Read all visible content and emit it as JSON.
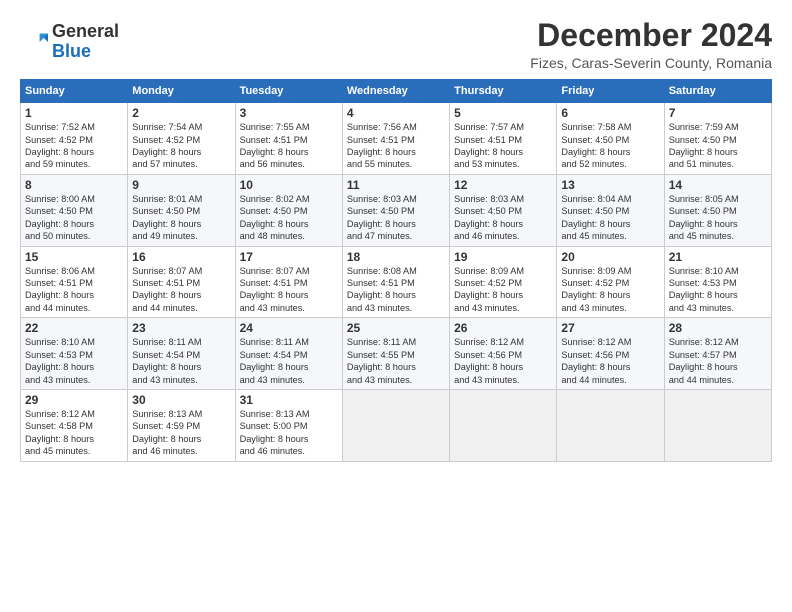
{
  "header": {
    "logo": {
      "general": "General",
      "blue": "Blue"
    },
    "title": "December 2024",
    "subtitle": "Fizes, Caras-Severin County, Romania"
  },
  "calendar": {
    "headers": [
      "Sunday",
      "Monday",
      "Tuesday",
      "Wednesday",
      "Thursday",
      "Friday",
      "Saturday"
    ],
    "rows": [
      [
        {
          "day": "1",
          "info": "Sunrise: 7:52 AM\nSunset: 4:52 PM\nDaylight: 8 hours\nand 59 minutes."
        },
        {
          "day": "2",
          "info": "Sunrise: 7:54 AM\nSunset: 4:52 PM\nDaylight: 8 hours\nand 57 minutes."
        },
        {
          "day": "3",
          "info": "Sunrise: 7:55 AM\nSunset: 4:51 PM\nDaylight: 8 hours\nand 56 minutes."
        },
        {
          "day": "4",
          "info": "Sunrise: 7:56 AM\nSunset: 4:51 PM\nDaylight: 8 hours\nand 55 minutes."
        },
        {
          "day": "5",
          "info": "Sunrise: 7:57 AM\nSunset: 4:51 PM\nDaylight: 8 hours\nand 53 minutes."
        },
        {
          "day": "6",
          "info": "Sunrise: 7:58 AM\nSunset: 4:50 PM\nDaylight: 8 hours\nand 52 minutes."
        },
        {
          "day": "7",
          "info": "Sunrise: 7:59 AM\nSunset: 4:50 PM\nDaylight: 8 hours\nand 51 minutes."
        }
      ],
      [
        {
          "day": "8",
          "info": "Sunrise: 8:00 AM\nSunset: 4:50 PM\nDaylight: 8 hours\nand 50 minutes."
        },
        {
          "day": "9",
          "info": "Sunrise: 8:01 AM\nSunset: 4:50 PM\nDaylight: 8 hours\nand 49 minutes."
        },
        {
          "day": "10",
          "info": "Sunrise: 8:02 AM\nSunset: 4:50 PM\nDaylight: 8 hours\nand 48 minutes."
        },
        {
          "day": "11",
          "info": "Sunrise: 8:03 AM\nSunset: 4:50 PM\nDaylight: 8 hours\nand 47 minutes."
        },
        {
          "day": "12",
          "info": "Sunrise: 8:03 AM\nSunset: 4:50 PM\nDaylight: 8 hours\nand 46 minutes."
        },
        {
          "day": "13",
          "info": "Sunrise: 8:04 AM\nSunset: 4:50 PM\nDaylight: 8 hours\nand 45 minutes."
        },
        {
          "day": "14",
          "info": "Sunrise: 8:05 AM\nSunset: 4:50 PM\nDaylight: 8 hours\nand 45 minutes."
        }
      ],
      [
        {
          "day": "15",
          "info": "Sunrise: 8:06 AM\nSunset: 4:51 PM\nDaylight: 8 hours\nand 44 minutes."
        },
        {
          "day": "16",
          "info": "Sunrise: 8:07 AM\nSunset: 4:51 PM\nDaylight: 8 hours\nand 44 minutes."
        },
        {
          "day": "17",
          "info": "Sunrise: 8:07 AM\nSunset: 4:51 PM\nDaylight: 8 hours\nand 43 minutes."
        },
        {
          "day": "18",
          "info": "Sunrise: 8:08 AM\nSunset: 4:51 PM\nDaylight: 8 hours\nand 43 minutes."
        },
        {
          "day": "19",
          "info": "Sunrise: 8:09 AM\nSunset: 4:52 PM\nDaylight: 8 hours\nand 43 minutes."
        },
        {
          "day": "20",
          "info": "Sunrise: 8:09 AM\nSunset: 4:52 PM\nDaylight: 8 hours\nand 43 minutes."
        },
        {
          "day": "21",
          "info": "Sunrise: 8:10 AM\nSunset: 4:53 PM\nDaylight: 8 hours\nand 43 minutes."
        }
      ],
      [
        {
          "day": "22",
          "info": "Sunrise: 8:10 AM\nSunset: 4:53 PM\nDaylight: 8 hours\nand 43 minutes."
        },
        {
          "day": "23",
          "info": "Sunrise: 8:11 AM\nSunset: 4:54 PM\nDaylight: 8 hours\nand 43 minutes."
        },
        {
          "day": "24",
          "info": "Sunrise: 8:11 AM\nSunset: 4:54 PM\nDaylight: 8 hours\nand 43 minutes."
        },
        {
          "day": "25",
          "info": "Sunrise: 8:11 AM\nSunset: 4:55 PM\nDaylight: 8 hours\nand 43 minutes."
        },
        {
          "day": "26",
          "info": "Sunrise: 8:12 AM\nSunset: 4:56 PM\nDaylight: 8 hours\nand 43 minutes."
        },
        {
          "day": "27",
          "info": "Sunrise: 8:12 AM\nSunset: 4:56 PM\nDaylight: 8 hours\nand 44 minutes."
        },
        {
          "day": "28",
          "info": "Sunrise: 8:12 AM\nSunset: 4:57 PM\nDaylight: 8 hours\nand 44 minutes."
        }
      ],
      [
        {
          "day": "29",
          "info": "Sunrise: 8:12 AM\nSunset: 4:58 PM\nDaylight: 8 hours\nand 45 minutes."
        },
        {
          "day": "30",
          "info": "Sunrise: 8:13 AM\nSunset: 4:59 PM\nDaylight: 8 hours\nand 46 minutes."
        },
        {
          "day": "31",
          "info": "Sunrise: 8:13 AM\nSunset: 5:00 PM\nDaylight: 8 hours\nand 46 minutes."
        },
        {
          "day": "",
          "info": ""
        },
        {
          "day": "",
          "info": ""
        },
        {
          "day": "",
          "info": ""
        },
        {
          "day": "",
          "info": ""
        }
      ]
    ]
  }
}
